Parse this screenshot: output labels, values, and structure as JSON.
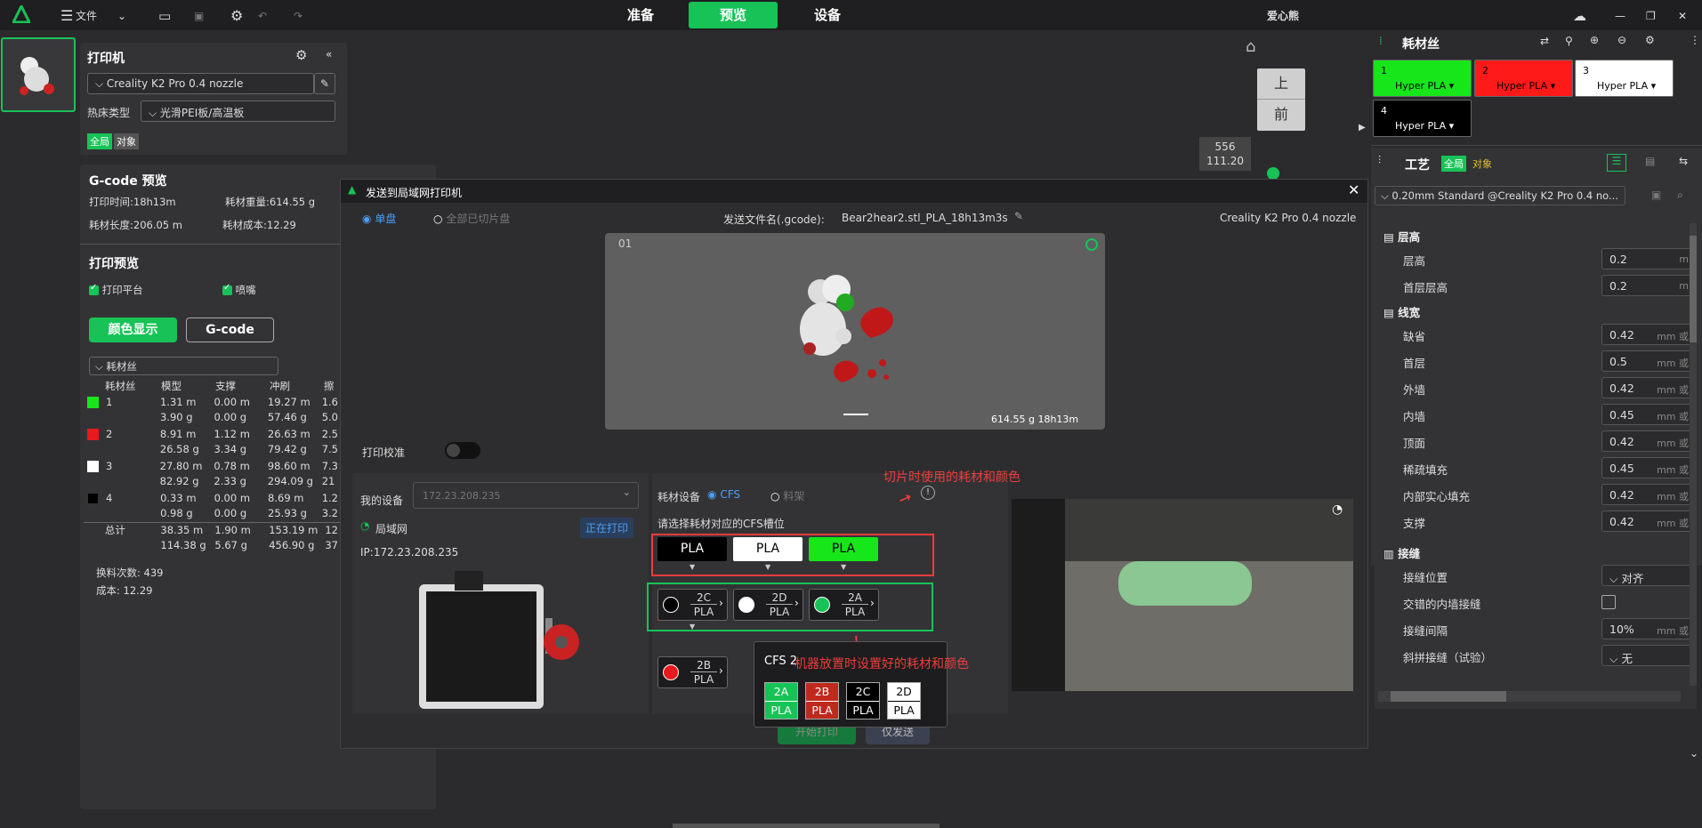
{
  "topbar": {
    "file": "文件",
    "tabs": [
      "准备",
      "预览",
      "设备"
    ],
    "user": "爱心熊"
  },
  "printer": {
    "title": "打印机",
    "nozzle": "Creality K2 Pro 0.4 nozzle",
    "bed_label": "热床类型",
    "bed": "光滑PEI板/高温板",
    "scope": [
      "全局",
      "对象"
    ]
  },
  "gcode": {
    "title": "G-code 预览",
    "print_time": "打印时间:18h13m",
    "weight": "耗材重量:614.55 g",
    "length": "耗材长度:206.05 m",
    "cost": "耗材成本:12.29",
    "preview_title": "打印预览",
    "cb1": "打印平台",
    "cb2": "喷嘴",
    "btn_color": "颜色显示",
    "btn_gcode": "G-code",
    "dropdown": "耗材丝",
    "headers": [
      "耗材丝",
      "模型",
      "支撑",
      "冲刷",
      "擦"
    ],
    "rows": [
      {
        "id": "1",
        "color": "#17e61a",
        "m": [
          "1.31 m",
          "3.90 g"
        ],
        "s": [
          "0.00 m",
          "0.00 g"
        ],
        "f": [
          "19.27 m",
          "57.46 g"
        ],
        "w": [
          "1.6",
          "5.0"
        ]
      },
      {
        "id": "2",
        "color": "#e8191f",
        "m": [
          "8.91 m",
          "26.58 g"
        ],
        "s": [
          "1.12 m",
          "3.34 g"
        ],
        "f": [
          "26.63 m",
          "79.42 g"
        ],
        "w": [
          "2.5",
          "7.5"
        ]
      },
      {
        "id": "3",
        "color": "#ffffff",
        "m": [
          "27.80 m",
          "82.92 g"
        ],
        "s": [
          "0.78 m",
          "2.33 g"
        ],
        "f": [
          "98.60 m",
          "294.09 g"
        ],
        "w": [
          "7.3",
          "21"
        ]
      },
      {
        "id": "4",
        "color": "#000000",
        "m": [
          "0.33 m",
          "0.98 g"
        ],
        "s": [
          "0.00 m",
          "0.00 g"
        ],
        "f": [
          "8.69 m",
          "25.93 g"
        ],
        "w": [
          "1.2",
          "3.2"
        ]
      }
    ],
    "total": {
      "label": "总计",
      "m": [
        "38.35 m",
        "114.38 g"
      ],
      "s": [
        "1.90 m",
        "5.67 g"
      ],
      "f": [
        "153.19 m",
        "456.90 g"
      ],
      "w": [
        "12",
        "37"
      ]
    },
    "changes": "换料次数:  439",
    "cost2": "成本:  12.29"
  },
  "viewport": {
    "cube_top": "上",
    "cube_front": "前",
    "coords": [
      "556",
      "111.20"
    ]
  },
  "dialog": {
    "title": "发送到局域网打印机",
    "single": "单盘",
    "all": "全部已切片盘",
    "filename_label": "发送文件名(.gcode):",
    "filename": "Bear2hear2.stl_PLA_18h13m3s",
    "printer": "Creality K2 Pro 0.4 nozzle",
    "plate": "01",
    "plate_info": "614.55 g  18h13m",
    "calib": "打印校准",
    "my_device": "我的设备",
    "ip_placeholder": "172.23.208.235",
    "lan": "局域网",
    "printing": "正在打印",
    "ip": "IP:172.23.208.235",
    "filament_dev": "耗材设备",
    "cfs": "CFS",
    "rack": "料架",
    "choose": "请选择耗材对应的CFS槽位",
    "annot1": "切片时使用的耗材和颜色",
    "annot2": "机器放置时设置好的耗材和颜色",
    "used": [
      {
        "label": "PLA",
        "bg": "#000000",
        "fg": "#fff"
      },
      {
        "label": "PLA",
        "bg": "#ffffff",
        "fg": "#000"
      },
      {
        "label": "PLA",
        "bg": "#17e61a",
        "fg": "#000"
      },
      {
        "label": "PLA",
        "bg": "#e8191f",
        "fg": "#fff"
      }
    ],
    "slots": [
      {
        "slot": "2C",
        "type": "PLA",
        "dot": "#000000"
      },
      {
        "slot": "2D",
        "type": "PLA",
        "dot": "#ffffff"
      },
      {
        "slot": "2A",
        "type": "PLA",
        "dot": "#17c357"
      },
      {
        "slot": "2B",
        "type": "PLA",
        "dot": "#e8191f"
      }
    ],
    "popup": {
      "title": "CFS 2",
      "cells": [
        {
          "slot": "2A",
          "type": "PLA",
          "bg": "#17c357",
          "fg": "#fff"
        },
        {
          "slot": "2B",
          "type": "PLA",
          "bg": "#c0291e",
          "fg": "#fff"
        },
        {
          "slot": "2C",
          "type": "PLA",
          "bg": "#000000",
          "fg": "#fff"
        },
        {
          "slot": "2D",
          "type": "PLA",
          "bg": "#ffffff",
          "fg": "#000"
        }
      ]
    },
    "start": "开始打印",
    "send": "仅发送"
  },
  "right": {
    "filament_title": "耗材丝",
    "cards": [
      {
        "n": "1",
        "name": "Hyper PLA",
        "bg": "#17e61a",
        "fg": "#000"
      },
      {
        "n": "2",
        "name": "Hyper PLA",
        "bg": "#ff1a1a",
        "fg": "#000"
      },
      {
        "n": "3",
        "name": "Hyper PLA",
        "bg": "#ffffff",
        "fg": "#000"
      },
      {
        "n": "4",
        "name": "Hyper PLA",
        "bg": "#000000",
        "fg": "#fff"
      }
    ],
    "process": "工艺",
    "global": "全局",
    "object": "对象",
    "preset": "0.20mm Standard @Creality K2 Pro 0.4 no...",
    "sec_layer": "层高",
    "layer": "层高",
    "layer_v": "0.2",
    "first_layer": "首层层高",
    "first_layer_v": "0.2",
    "sec_width": "线宽",
    "rows": [
      {
        "l": "缺省",
        "v": "0.42"
      },
      {
        "l": "首层",
        "v": "0.5"
      },
      {
        "l": "外墙",
        "v": "0.42"
      },
      {
        "l": "内墙",
        "v": "0.45"
      },
      {
        "l": "顶面",
        "v": "0.42"
      },
      {
        "l": "稀疏填充",
        "v": "0.45"
      },
      {
        "l": "内部实心填充",
        "v": "0.42"
      },
      {
        "l": "支撑",
        "v": "0.42"
      }
    ],
    "unit": "mm 或",
    "sec_seam": "接缝",
    "seam_pos": "接缝位置",
    "seam_pos_v": "对齐",
    "stagger": "交错的内墙接缝",
    "seam_gap": "接缝间隔",
    "seam_gap_v": "10%",
    "scarf": "斜拼接缝（试验）",
    "scarf_v": "无",
    "unit2": "mm 或"
  }
}
